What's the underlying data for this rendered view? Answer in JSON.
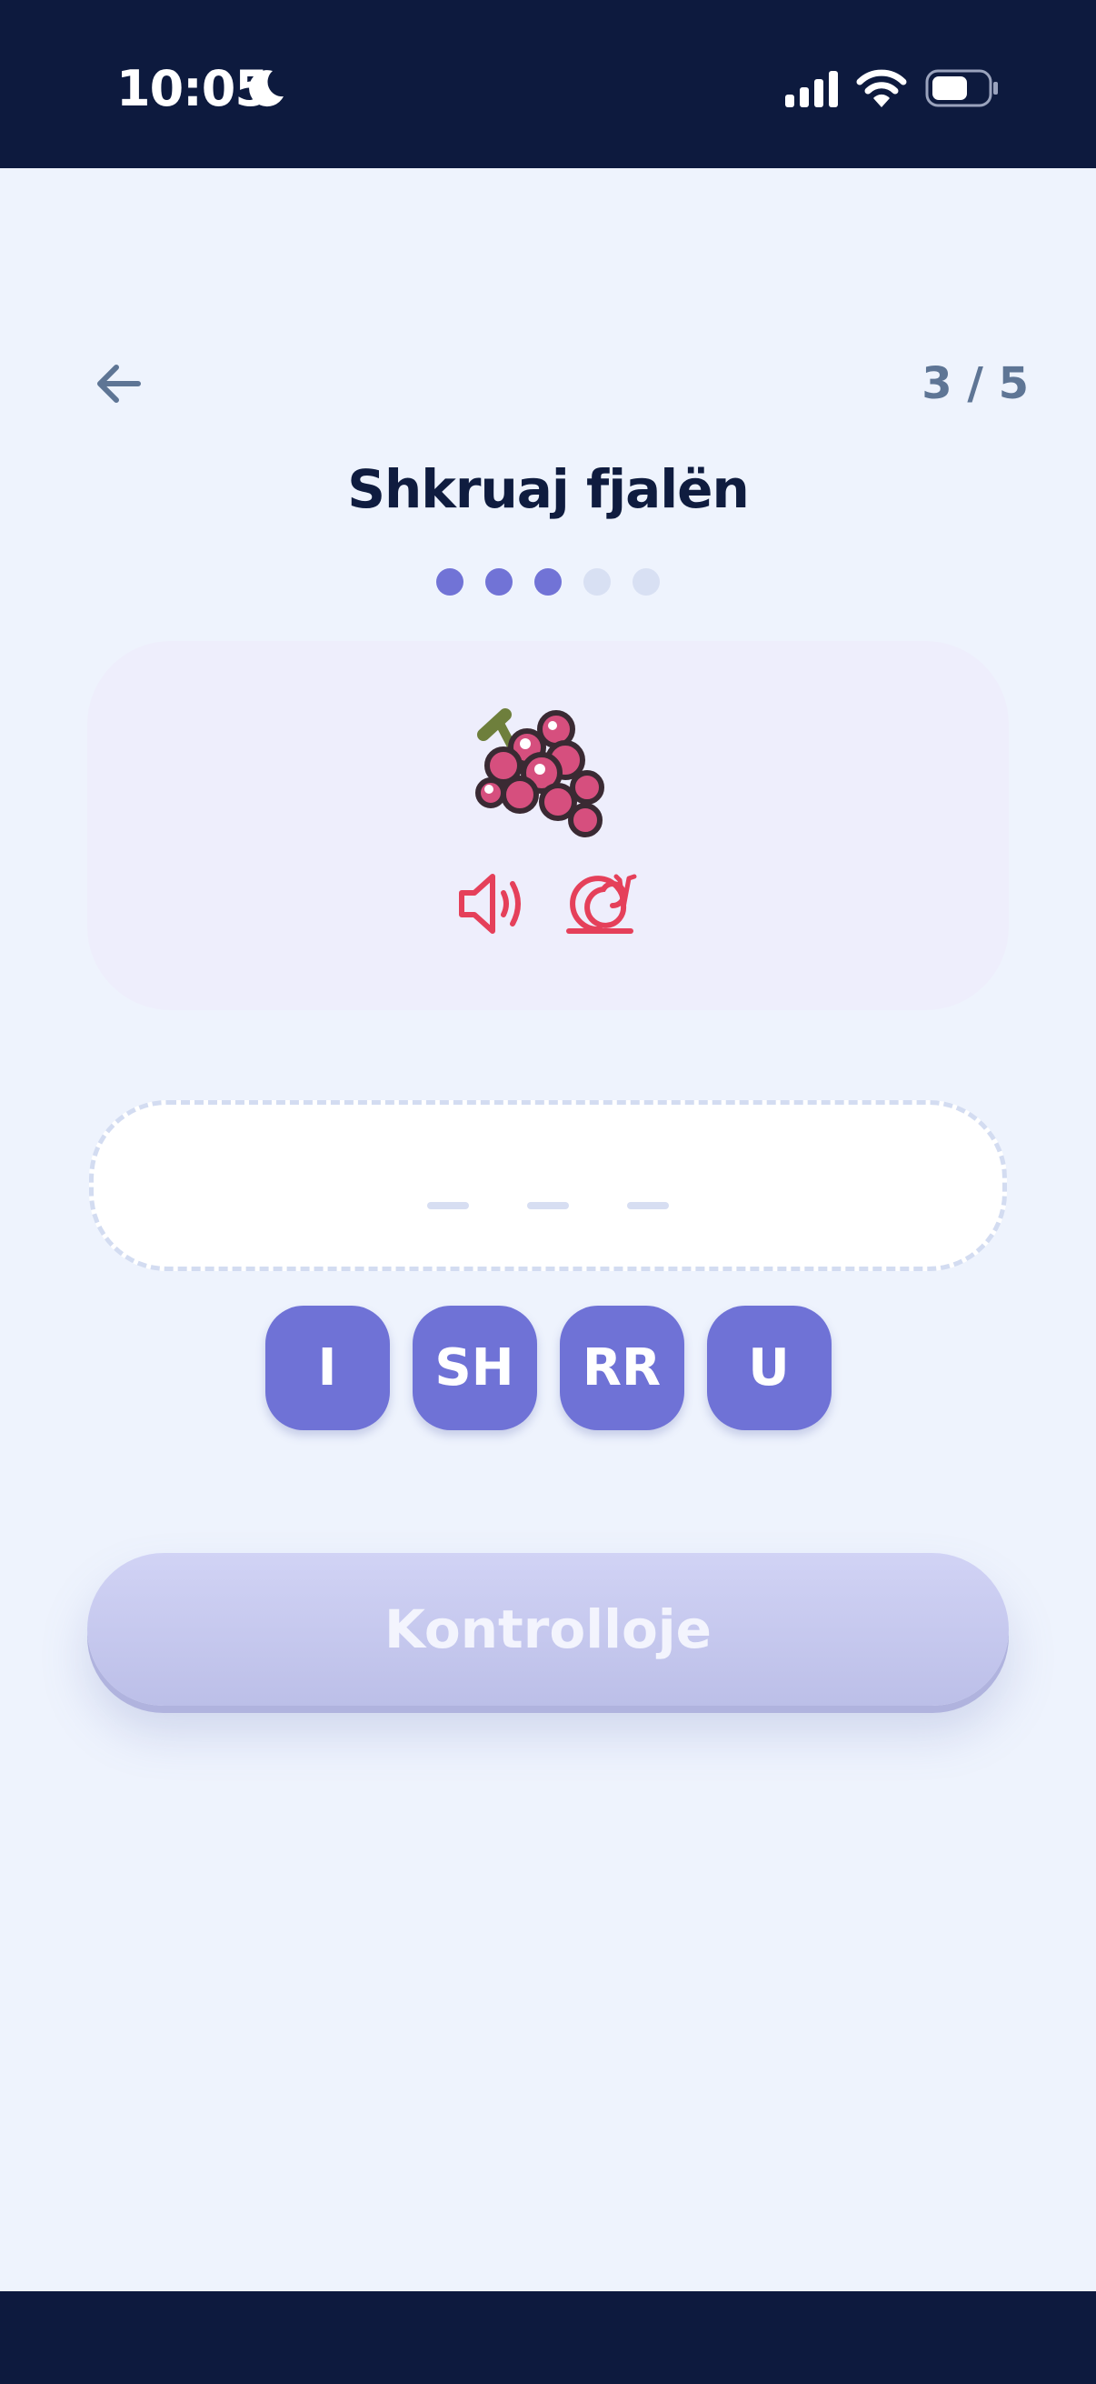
{
  "status_bar": {
    "time": "10:05",
    "icons": [
      "moon-icon",
      "signal-icon",
      "wifi-icon",
      "battery-icon"
    ]
  },
  "header": {
    "back_icon": "arrow-left-icon",
    "progress": "3 / 5",
    "title": "Shkruaj fjalën"
  },
  "steps": {
    "total": 5,
    "completed": 3
  },
  "word_card": {
    "image_icon": "grape-icon",
    "audio_icon": "speaker-icon",
    "slow_audio_icon": "snail-icon"
  },
  "answer": {
    "slots": 3
  },
  "letter_tiles": [
    "I",
    "SH",
    "RR",
    "U"
  ],
  "check_button": {
    "label": "Kontrolloje"
  },
  "colors": {
    "navy": "#0d1a3e",
    "background": "#eef3fd",
    "accent": "#6f72d6",
    "audio_red": "#e5405a",
    "button_disabled": "#c6c8ef"
  }
}
